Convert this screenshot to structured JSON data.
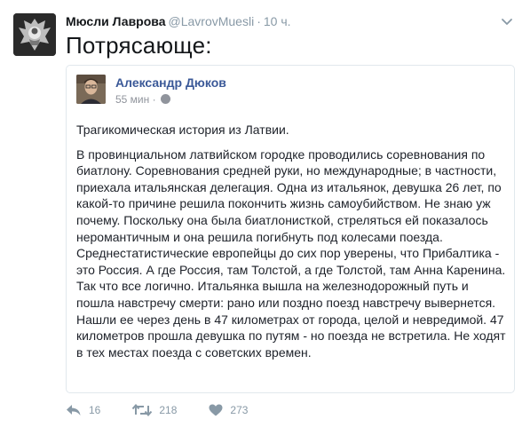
{
  "author": {
    "name": "Мюсли Лаврова",
    "handle": "@LavrovMuesli",
    "separator": "·",
    "time": "10 ч."
  },
  "tweet": {
    "text": "Потрясающе:"
  },
  "embedded_post": {
    "author": "Александр Дюков",
    "time": "55 мин",
    "separator": "·",
    "paragraphs": [
      "Трагикомическая история из Латвии.",
      "В провинциальном латвийском городке проводились соревнования по биатлону. Соревнования средней руки, но международные; в частности, приехала итальянская делегация. Одна из итальянок, девушка 26 лет, по какой-то причине решила покончить жизнь самоубийством. Не знаю уж почему. Поскольку она была биатлонисткой, стреляться ей показалось неромантичным и она решила погибнуть под колесами поезда. Среднестатистические европейцы до сих пор уверены, что Прибалтика - это Россия. А где Россия, там Толстой, а где Толстой, там Анна Каренина. Так что все логично. Итальянка вышла на железнодорожный путь и пошла навстречу смерти: рано или поздно поезд навстречу вывернется. Нашли ее через день в 47 километрах от города, целой и невредимой. 47 километров прошла девушка по путям - но поезда не встретила. Не ходят в тех местах поезда с советских времен."
    ]
  },
  "actions": {
    "reply_count": "16",
    "retweet_count": "218",
    "like_count": "273"
  },
  "icons": {
    "caret": "chevron-down-icon",
    "reply": "reply-icon",
    "retweet": "retweet-icon",
    "like": "heart-icon",
    "privacy": "globe-icon"
  },
  "colors": {
    "secondary_text": "#8899a6",
    "facebook_name": "#3b5998"
  }
}
